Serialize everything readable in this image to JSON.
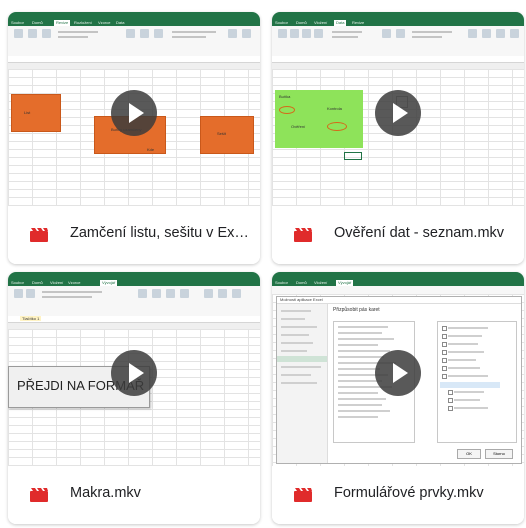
{
  "videos": [
    {
      "title": "Zamčení listu, sešitu v Excelu",
      "icon": "video-file-icon",
      "excel_tabs": [
        "Soubor",
        "Domů",
        "Vložení",
        "Rozložení",
        "Vzorce",
        "Data",
        "Revize",
        "Zobrazení"
      ],
      "selected_tab": "Revize",
      "shape_labels": [
        "List",
        "Buňky uzamčeny",
        "Kde",
        "Sešit"
      ]
    },
    {
      "title": "Ověření dat - seznam.mkv",
      "icon": "video-file-icon",
      "excel_tabs": [
        "Soubor",
        "Domů",
        "Vložení",
        "Rozložení",
        "Vzorce",
        "Data",
        "Revize",
        "Zobrazení"
      ],
      "selected_tab": "Data",
      "shape_labels": [
        "Buňka",
        "Kontrola",
        "Ověření",
        "Hodnota"
      ]
    },
    {
      "title": "Makra.mkv",
      "icon": "video-file-icon",
      "excel_tabs": [
        "Soubor",
        "Domů",
        "Vložení",
        "Rozložení",
        "Vzorce",
        "Data",
        "Revize",
        "Vývojář"
      ],
      "selected_tab": "Vývojář",
      "button_text": "PŘEJDI NA FORMÁŘ",
      "name_box": "Tlačítko 1"
    },
    {
      "title": "Formulářové prvky.mkv",
      "icon": "video-file-icon",
      "excel_tabs": [
        "Soubor",
        "Domů",
        "Vložení",
        "Rozložení",
        "Vzorce",
        "Data",
        "Revize",
        "Zobrazení"
      ],
      "selected_tab": "Vývojář",
      "dialog_title": "Možnosti aplikace Excel",
      "dialog_heading": "Přizpůsobit pás karet",
      "dialog_buttons": [
        "OK",
        "Storno"
      ]
    }
  ],
  "colors": {
    "excel_green": "#217346",
    "shape_orange": "#e46d2b",
    "shape_green": "#8ee35a",
    "video_icon_red": "#e02b2b"
  }
}
